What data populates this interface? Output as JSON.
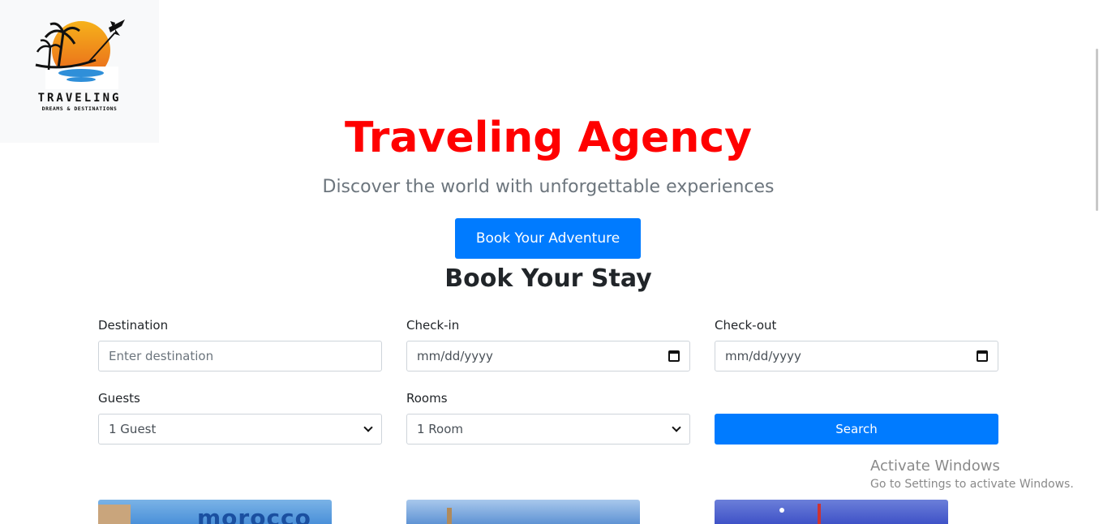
{
  "logo": {
    "title": "TRAVELING",
    "tagline": "DREAMS & DESTINATIONS"
  },
  "hero": {
    "title": "Traveling Agency",
    "subtitle": "Discover the world with unforgettable experiences",
    "cta_label": "Book Your Adventure"
  },
  "booking": {
    "title": "Book Your Stay",
    "destination": {
      "label": "Destination",
      "placeholder": "Enter destination"
    },
    "checkin": {
      "label": "Check-in",
      "value": "mm/dd/yyyy"
    },
    "checkout": {
      "label": "Check-out",
      "value": "mm/dd/yyyy"
    },
    "guests": {
      "label": "Guests",
      "selected": "1 Guest"
    },
    "rooms": {
      "label": "Rooms",
      "selected": "1 Room"
    },
    "search_label": "Search"
  },
  "cards": [
    {
      "text": "morocco"
    },
    {
      "text": ""
    },
    {
      "text": ""
    }
  ],
  "watermark": {
    "title": "Activate Windows",
    "subtitle": "Go to Settings to activate Windows."
  },
  "colors": {
    "title_red": "#ff0000",
    "primary_blue": "#007bff"
  }
}
